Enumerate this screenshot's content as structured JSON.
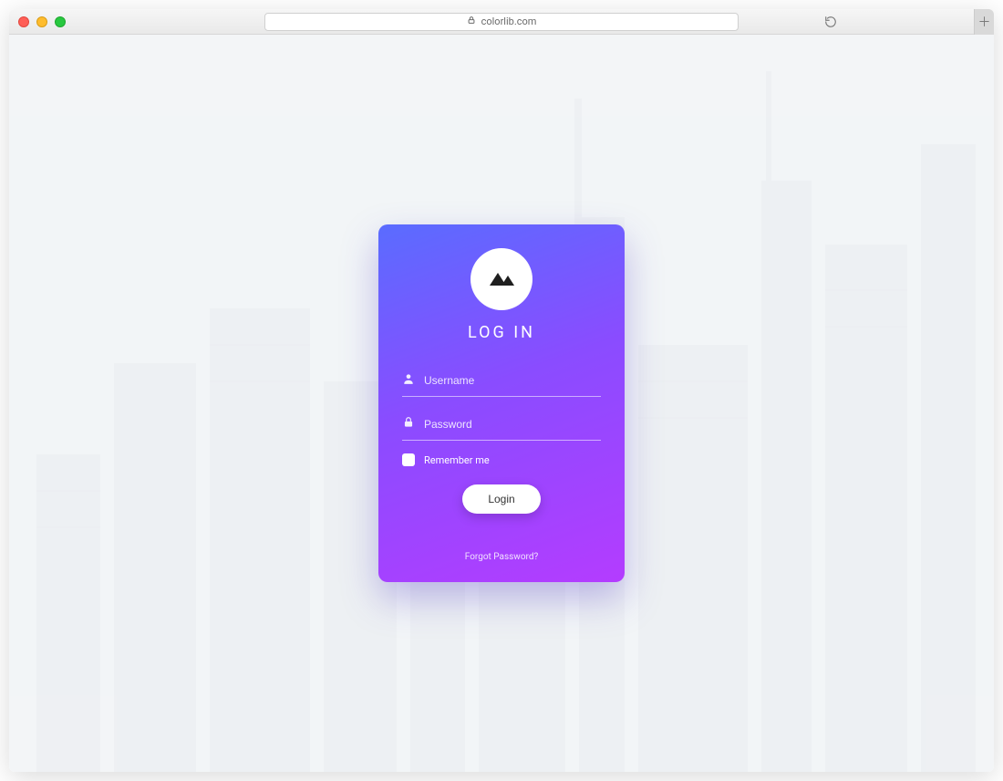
{
  "browser": {
    "address_text": "colorlib.com",
    "lock_icon": "lock-icon"
  },
  "login": {
    "title": "LOG IN",
    "username": {
      "placeholder": "Username",
      "value": ""
    },
    "password": {
      "placeholder": "Password",
      "value": ""
    },
    "remember_label": "Remember me",
    "submit_label": "Login",
    "forgot_label": "Forgot Password?",
    "logo_icon": "mountain-icon",
    "colors": {
      "gradient_start": "#5a6cff",
      "gradient_mid": "#8a4cff",
      "gradient_end": "#b43cff",
      "button_bg": "#ffffff",
      "button_text": "#333333"
    }
  }
}
